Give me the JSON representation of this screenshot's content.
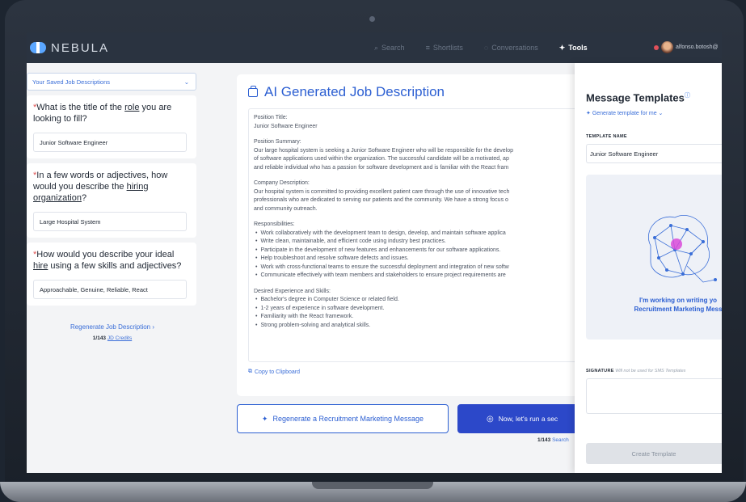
{
  "app": {
    "name": "NEBULA"
  },
  "nav": {
    "items": [
      {
        "label": "Search",
        "icon": "search-icon"
      },
      {
        "label": "Shortlists",
        "icon": "list-icon"
      },
      {
        "label": "Conversations",
        "icon": "chat-icon"
      },
      {
        "label": "Tools",
        "icon": "sparkle-icon"
      }
    ],
    "user_name": "alfonso.botosh@"
  },
  "left": {
    "saved_select": "Your Saved Job Descriptions",
    "questions": [
      {
        "pre": "What is the title of the ",
        "u": "role",
        "post": " you are looking to fill?",
        "value": "Junior Software Engineer"
      },
      {
        "pre": "In a few words or adjectives, how would you describe the ",
        "u": "hiring organization",
        "post": "?",
        "value": "Large Hospital System"
      },
      {
        "pre": "How would you describe your ideal ",
        "u": "hire",
        "post": " using a few skills and adjectives?",
        "value": "Approachable, Genuine, Reliable, React"
      }
    ],
    "regenerate_label": "Regenerate Job Description",
    "credits_count": "1/143",
    "credits_link": "JD Credits"
  },
  "jd": {
    "title": "AI Generated Job Description",
    "position_title_heading": "Position Title:",
    "position_title": "Junior Software Engineer",
    "summary_heading": "Position Summary:",
    "summary_lines": [
      "Our large hospital system is seeking a Junior Software Engineer who will be responsible for the develop",
      "of software applications used within the organization. The successful candidate will be a motivated, ap",
      "and reliable individual who has a passion for software development and is familiar with the React fram"
    ],
    "company_heading": "Company Description:",
    "company_lines": [
      "Our hospital system is committed to providing excellent patient care through the use of innovative tech",
      "professionals who are dedicated to serving our patients and the community. We have a strong focus o",
      "and community outreach."
    ],
    "resp_heading": "Responsibilities:",
    "responsibilities": [
      "Work collaboratively with the development team to design, develop, and maintain software applica",
      "Write clean, maintainable, and efficient code using industry best practices.",
      "Participate in the development of new features and enhancements for our software applications.",
      "Help troubleshoot and resolve software defects and issues.",
      "Work with cross-functional teams to ensure the successful deployment and integration of new softw",
      "Communicate effectively with team members and stakeholders to ensure project requirements are"
    ],
    "exp_heading": "Desired Experience and Skills:",
    "experience": [
      "Bachelor's degree in Computer Science or related field.",
      "1-2 years of experience in software development.",
      "Familiarity with the React framework.",
      "Strong problem-solving and analytical skills."
    ],
    "copy_label": "Copy to Clipboard"
  },
  "actions": {
    "regen_message": "Regenerate a Recruitment Marketing Message",
    "run_search": "Now, let's run a sec",
    "search_credits_count": "1/143",
    "search_credits_link": "Search"
  },
  "templates": {
    "title": "Message Templates",
    "generate_link": "Generate template for me",
    "template_name_label": "TEMPLATE NAME",
    "template_name_value": "Junior Software Engineer",
    "working_line1": "I'm working on writing yo",
    "working_line2": "Recruitment Marketing Mess",
    "signature_label": "SIGNATURE",
    "signature_note": "Will not be used for SMS Templates",
    "create_button": "Create Template"
  },
  "colors": {
    "accent": "#2c5fd2",
    "nav_bg": "#2a3340",
    "required": "#e05050"
  }
}
